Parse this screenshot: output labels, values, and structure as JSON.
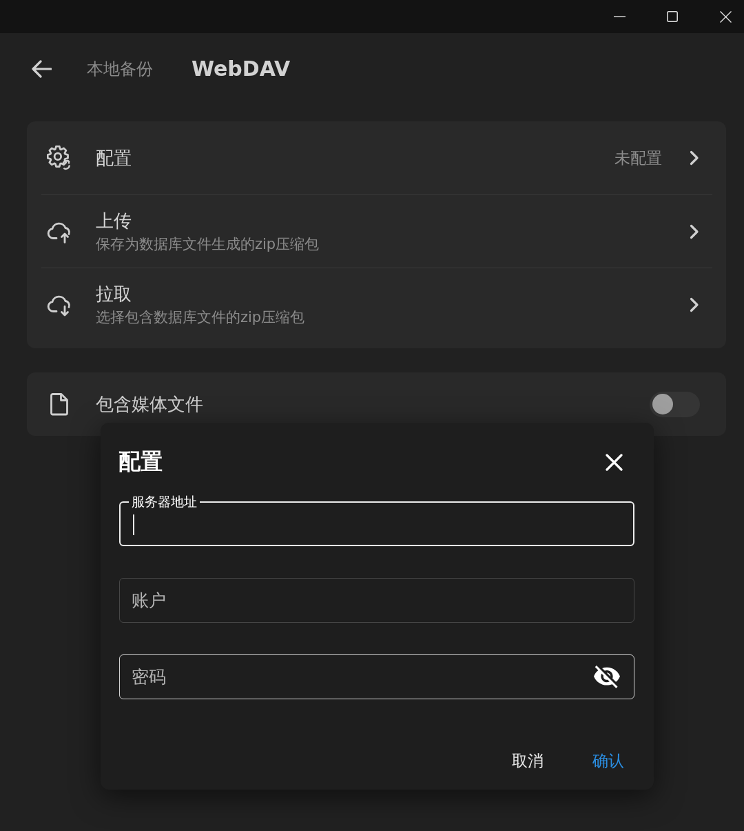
{
  "header": {
    "tabs": [
      {
        "label": "本地备份",
        "selected": false
      },
      {
        "label": "WebDAV",
        "selected": true
      }
    ]
  },
  "webdav_card": {
    "items": [
      {
        "title": "配置",
        "value": "未配置"
      },
      {
        "title": "上传",
        "subtitle": "保存为数据库文件生成的zip压缩包"
      },
      {
        "title": "拉取",
        "subtitle": "选择包含数据库文件的zip压缩包"
      }
    ]
  },
  "media_card": {
    "label": "包含媒体文件",
    "on": false
  },
  "dialog": {
    "title": "配置",
    "fields": [
      {
        "label": "服务器地址",
        "kind": "text",
        "focused": true,
        "hovered": false
      },
      {
        "label": "账户",
        "kind": "text",
        "focused": false,
        "hovered": false
      },
      {
        "label": "密码",
        "kind": "password",
        "focused": false,
        "hovered": true
      }
    ],
    "buttons": [
      {
        "label": "取消",
        "kind": "text"
      },
      {
        "label": "确认",
        "kind": "primary"
      }
    ]
  }
}
